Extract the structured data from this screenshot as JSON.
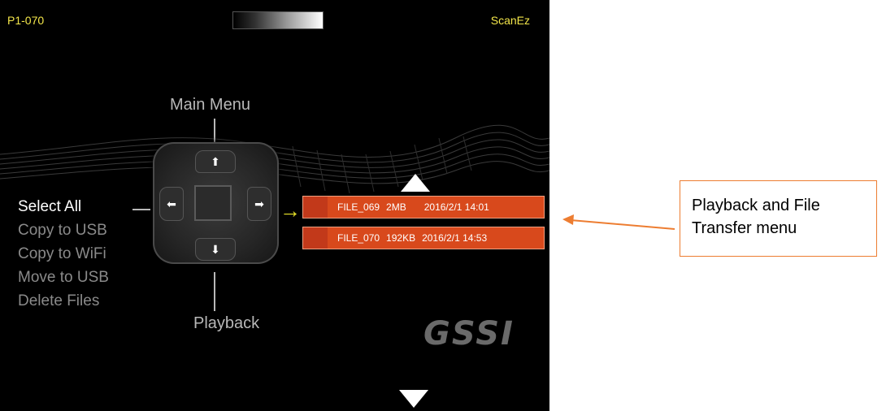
{
  "status": {
    "file_id": "P1-070",
    "mode": "ScanEz"
  },
  "dpad": {
    "up_label": "Main Menu",
    "down_label": "Playback",
    "up_icon": "arrow-up-icon",
    "down_icon": "arrow-down-icon",
    "left_icon": "arrow-left-icon",
    "right_icon": "arrow-right-icon"
  },
  "actions": [
    "Select All",
    "Copy to USB",
    "Copy to WiFi",
    "Move to USB",
    "Delete Files"
  ],
  "selected_action": "Select All",
  "files": [
    {
      "name": "FILE_069",
      "size": "2MB",
      "date": "2016/2/1 14:01"
    },
    {
      "name": "FILE_070",
      "size": "192KB",
      "date": "2016/2/1 14:53"
    }
  ],
  "logo_text": "GSSI",
  "callout": {
    "text": "Playback and File Transfer menu"
  },
  "colors": {
    "status_text": "#f3e64a",
    "file_row": "#d8491c",
    "callout_border": "#ed7d31",
    "selection_arrow": "#e8e32a"
  }
}
